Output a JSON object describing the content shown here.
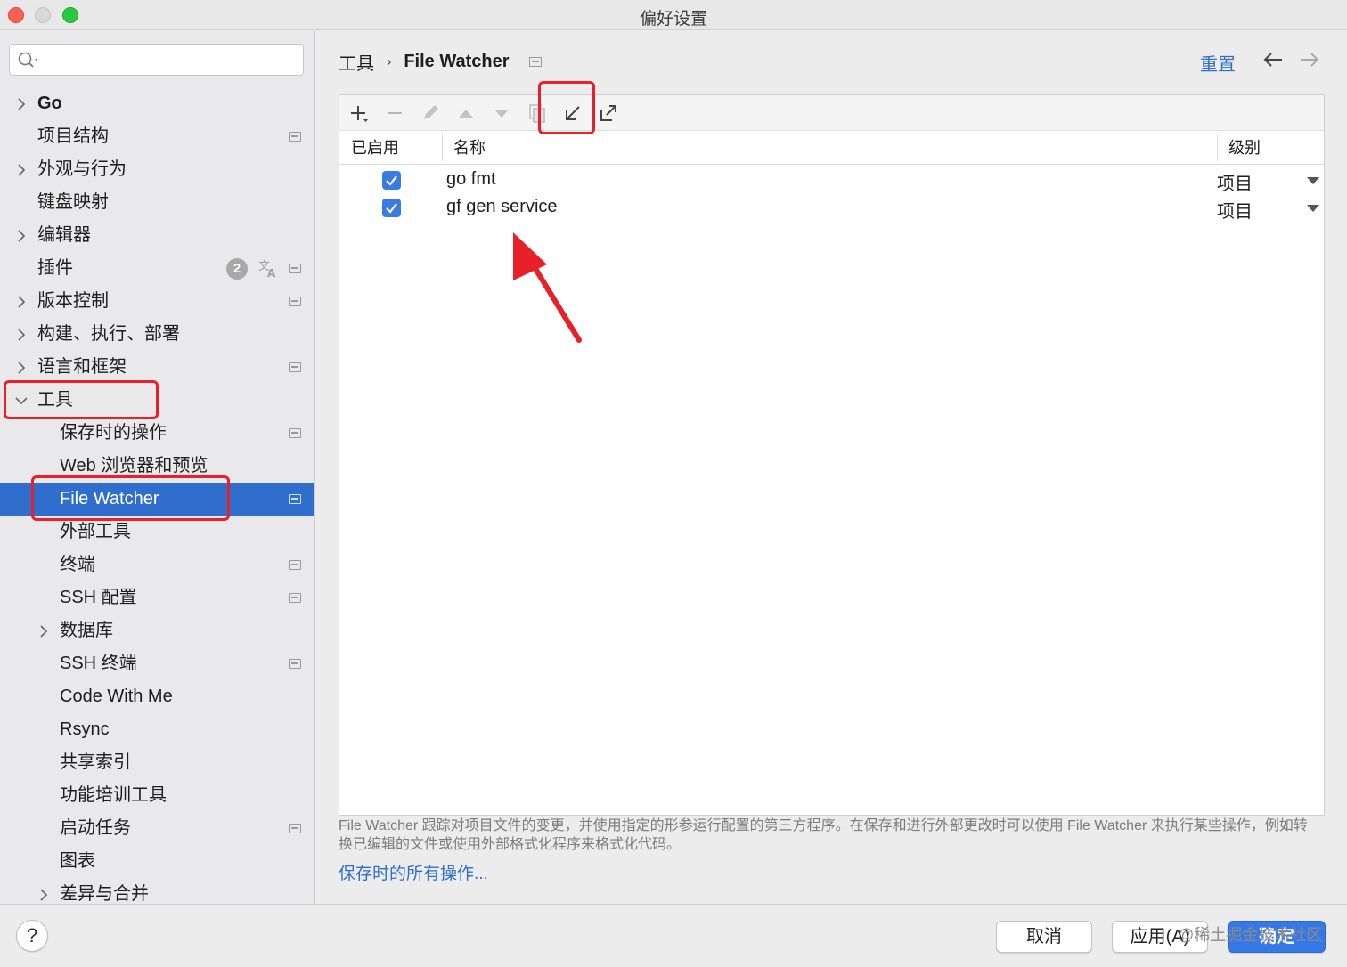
{
  "window": {
    "title": "偏好设置"
  },
  "sidebar": {
    "search": {
      "value": "",
      "placeholder": ""
    },
    "plugins_badge": "2",
    "items": [
      {
        "label": "Go",
        "level": 0,
        "expandable": true,
        "bold": true
      },
      {
        "label": "项目结构",
        "level": 0,
        "expandable": false,
        "page_mark": true
      },
      {
        "label": "外观与行为",
        "level": 0,
        "expandable": true
      },
      {
        "label": "键盘映射",
        "level": 0,
        "expandable": false
      },
      {
        "label": "编辑器",
        "level": 0,
        "expandable": true
      },
      {
        "label": "插件",
        "level": 0,
        "expandable": false,
        "page_mark": true
      },
      {
        "label": "版本控制",
        "level": 0,
        "expandable": true,
        "page_mark": true
      },
      {
        "label": "构建、执行、部署",
        "level": 0,
        "expandable": true
      },
      {
        "label": "语言和框架",
        "level": 0,
        "expandable": true,
        "page_mark": true
      },
      {
        "label": "工具",
        "level": 0,
        "expandable": true,
        "expanded": true
      },
      {
        "label": "保存时的操作",
        "level": 1,
        "page_mark": true
      },
      {
        "label": "Web 浏览器和预览",
        "level": 1
      },
      {
        "label": "File Watcher",
        "level": 1,
        "selected": true,
        "page_mark": true
      },
      {
        "label": "外部工具",
        "level": 1
      },
      {
        "label": "终端",
        "level": 1,
        "page_mark": true
      },
      {
        "label": "SSH 配置",
        "level": 1,
        "page_mark": true
      },
      {
        "label": "数据库",
        "level": 1,
        "expandable": true
      },
      {
        "label": "SSH 终端",
        "level": 1,
        "page_mark": true
      },
      {
        "label": "Code With Me",
        "level": 1
      },
      {
        "label": "Rsync",
        "level": 1
      },
      {
        "label": "共享索引",
        "level": 1
      },
      {
        "label": "功能培训工具",
        "level": 1
      },
      {
        "label": "启动任务",
        "level": 1,
        "page_mark": true
      },
      {
        "label": "图表",
        "level": 1
      },
      {
        "label": "差异与合并",
        "level": 1,
        "expandable": true
      }
    ]
  },
  "header": {
    "breadcrumb_parent": "工具",
    "breadcrumb_current": "File Watcher",
    "reset_label": "重置"
  },
  "table": {
    "columns": {
      "enabled": "已启用",
      "name": "名称",
      "level": "级别"
    },
    "rows": [
      {
        "enabled": true,
        "name": "go fmt",
        "level": "项目"
      },
      {
        "enabled": true,
        "name": "gf gen service",
        "level": "项目"
      }
    ]
  },
  "footer": {
    "description": "File Watcher 跟踪对项目文件的变更，并使用指定的形参运行配置的第三方程序。在保存和进行外部更改时可以使用 File Watcher 来执行某些操作，例如转换已编辑的文件或使用外部格式化程序来格式化代码。",
    "link": "保存时的所有操作..."
  },
  "buttons": {
    "help": "?",
    "cancel": "取消",
    "apply": "应用(A)",
    "ok": "确定"
  },
  "watermark": "@稀土掘金技术社区",
  "colors": {
    "accent": "#2f6ecc",
    "selection": "#2f6ecc",
    "annotation": "#e8202a"
  },
  "icons": [
    "search-icon",
    "add-icon",
    "remove-icon",
    "edit-icon",
    "move-up-icon",
    "move-down-icon",
    "copy-icon",
    "import-icon",
    "export-icon",
    "back-arrow-icon",
    "forward-arrow-icon",
    "translate-icon"
  ]
}
